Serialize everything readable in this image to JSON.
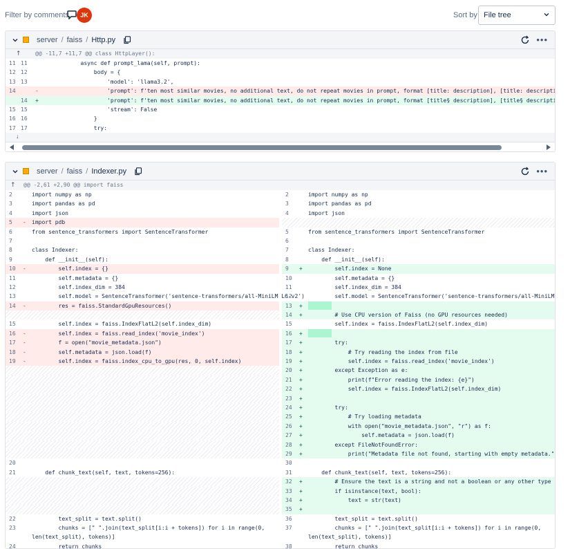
{
  "topbar": {
    "filter_label": "Filter by comments",
    "avatar_initials": "JK",
    "avatar_color": "#de350b",
    "sort_label": "Sort by",
    "sort_value": "File tree"
  },
  "file1": {
    "path": [
      "server",
      "faiss",
      "Http.py"
    ],
    "hunk": "@@ -11,7 +11,7 @@ class HttpLayer():",
    "lines": [
      {
        "o": "11",
        "n": "11",
        "m": "",
        "t": "        async def prompt_lama(self, prompt):",
        "k": "ctx"
      },
      {
        "o": "12",
        "n": "12",
        "m": "",
        "t": "            body = {",
        "k": "ctx"
      },
      {
        "o": "13",
        "n": "13",
        "m": "",
        "t": "                'model': 'llama3.2',",
        "k": "ctx"
      },
      {
        "o": "14",
        "n": "",
        "m": "-",
        "t": "                'prompt': f'ten most similar movies, no additional text, do not repeat movies in prompt, format [title: description], [title: description], given the followi",
        "k": "del"
      },
      {
        "o": "",
        "n": "14",
        "m": "+",
        "t": "                'prompt': f'ten most similar movies, no additional text, do not repeat movies in prompt, format [title§ description], [title§ description], given the followi",
        "k": "add"
      },
      {
        "o": "15",
        "n": "15",
        "m": "",
        "t": "                'stream': False",
        "k": "ctx"
      },
      {
        "o": "16",
        "n": "16",
        "m": "",
        "t": "            }",
        "k": "ctx"
      },
      {
        "o": "17",
        "n": "17",
        "m": "",
        "t": "            try:",
        "k": "ctx"
      }
    ]
  },
  "file2": {
    "path": [
      "server",
      "faiss",
      "Indexer.py"
    ],
    "hunk": "@@ -2,61 +2,90 @@ import faiss",
    "left": [
      {
        "n": "2",
        "m": "",
        "t": "import numpy as np",
        "k": "ctx"
      },
      {
        "n": "3",
        "m": "",
        "t": "import pandas as pd",
        "k": "ctx"
      },
      {
        "n": "4",
        "m": "",
        "t": "import json",
        "k": "ctx"
      },
      {
        "n": "5",
        "m": "-",
        "t": "import pdb",
        "k": "del"
      },
      {
        "n": "6",
        "m": "",
        "t": "from sentence_transformers import SentenceTransformer",
        "k": "ctx"
      },
      {
        "n": "7",
        "m": "",
        "t": "",
        "k": "ctx"
      },
      {
        "n": "8",
        "m": "",
        "t": "class Indexer:",
        "k": "ctx"
      },
      {
        "n": "9",
        "m": "",
        "t": "    def __init__(self):",
        "k": "ctx"
      },
      {
        "n": "10",
        "m": "-",
        "t": "        self.index = {}",
        "k": "del"
      },
      {
        "n": "11",
        "m": "",
        "t": "        self.metadata = {}",
        "k": "ctx"
      },
      {
        "n": "12",
        "m": "",
        "t": "        self.index_dim = 384",
        "k": "ctx"
      },
      {
        "n": "13",
        "m": "",
        "t": "        self.model = SentenceTransformer('sentence-transformers/all-MiniLM-L6-v2')",
        "k": "ctx"
      },
      {
        "n": "14",
        "m": "-",
        "t": "        res = faiss.StandardGpuResources()",
        "k": "del"
      },
      {
        "n": "",
        "m": "",
        "t": "",
        "k": "empty"
      },
      {
        "n": "15",
        "m": "",
        "t": "        self.index = faiss.IndexFlatL2(self.index_dim)",
        "k": "ctx"
      },
      {
        "n": "16",
        "m": "-",
        "t": "        self.index = faiss.read_index('movie_index')",
        "k": "del"
      },
      {
        "n": "17",
        "m": "-",
        "t": "        f = open(\"movie_metadata.json\")",
        "k": "del"
      },
      {
        "n": "18",
        "m": "-",
        "t": "        self.metadata = json.load(f)",
        "k": "del"
      },
      {
        "n": "19",
        "m": "-",
        "t": "        self.index = faiss.index_cpu_to_gpu(res, 0, self.index)",
        "k": "del"
      },
      {
        "n": "",
        "m": "",
        "t": "",
        "k": "empty"
      },
      {
        "n": "",
        "m": "",
        "t": "",
        "k": "empty"
      },
      {
        "n": "",
        "m": "",
        "t": "",
        "k": "empty"
      },
      {
        "n": "",
        "m": "",
        "t": "",
        "k": "empty"
      },
      {
        "n": "",
        "m": "",
        "t": "",
        "k": "empty"
      },
      {
        "n": "",
        "m": "",
        "t": "",
        "k": "empty"
      },
      {
        "n": "",
        "m": "",
        "t": "",
        "k": "empty"
      },
      {
        "n": "",
        "m": "",
        "t": "",
        "k": "empty"
      },
      {
        "n": "",
        "m": "",
        "t": "",
        "k": "empty"
      },
      {
        "n": "",
        "m": "",
        "t": "",
        "k": "empty"
      },
      {
        "n": "20",
        "m": "",
        "t": "",
        "k": "ctx"
      },
      {
        "n": "21",
        "m": "",
        "t": "    def chunk_text(self, text, tokens=256):",
        "k": "ctx"
      },
      {
        "n": "",
        "m": "",
        "t": "",
        "k": "empty"
      },
      {
        "n": "",
        "m": "",
        "t": "",
        "k": "empty"
      },
      {
        "n": "",
        "m": "",
        "t": "",
        "k": "empty"
      },
      {
        "n": "",
        "m": "",
        "t": "",
        "k": "empty"
      },
      {
        "n": "22",
        "m": "",
        "t": "        text_split = text.split()",
        "k": "ctx"
      },
      {
        "n": "23",
        "m": "",
        "t": "        chunks = [\" \".join(text_split[i:i + tokens]) for i in range(0,",
        "k": "ctx"
      },
      {
        "n": "",
        "m": "",
        "t": "len(text_split), tokens)]",
        "k": "ctx"
      },
      {
        "n": "24",
        "m": "",
        "t": "        return chunks",
        "k": "ctx"
      }
    ],
    "right": [
      {
        "n": "2",
        "m": "",
        "t": "import numpy as np",
        "k": "ctx"
      },
      {
        "n": "3",
        "m": "",
        "t": "import pandas as pd",
        "k": "ctx"
      },
      {
        "n": "4",
        "m": "",
        "t": "import json",
        "k": "ctx"
      },
      {
        "n": "",
        "m": "",
        "t": "",
        "k": "empty"
      },
      {
        "n": "5",
        "m": "",
        "t": "from sentence_transformers import SentenceTransformer",
        "k": "ctx"
      },
      {
        "n": "6",
        "m": "",
        "t": "",
        "k": "ctx"
      },
      {
        "n": "7",
        "m": "",
        "t": "class Indexer:",
        "k": "ctx"
      },
      {
        "n": "8",
        "m": "",
        "t": "    def __init__(self):",
        "k": "ctx"
      },
      {
        "n": "9",
        "m": "+",
        "t": "        self.index = None",
        "k": "add"
      },
      {
        "n": "10",
        "m": "",
        "t": "        self.metadata = {}",
        "k": "ctx"
      },
      {
        "n": "11",
        "m": "",
        "t": "        self.index_dim = 384",
        "k": "ctx"
      },
      {
        "n": "12",
        "m": "",
        "t": "        self.model = SentenceTransformer('sentence-transformers/all-MiniLM-L6-v2')",
        "k": "ctx"
      },
      {
        "n": "13",
        "m": "+",
        "t": "",
        "k": "addbox"
      },
      {
        "n": "14",
        "m": "+",
        "t": "        # Use CPU version of Faiss (no GPU resources needed)",
        "k": "add"
      },
      {
        "n": "15",
        "m": "",
        "t": "        self.index = faiss.IndexFlatL2(self.index_dim)",
        "k": "ctx"
      },
      {
        "n": "16",
        "m": "+",
        "t": "",
        "k": "addbox"
      },
      {
        "n": "17",
        "m": "+",
        "t": "        try:",
        "k": "add"
      },
      {
        "n": "18",
        "m": "+",
        "t": "            # Try reading the index from file",
        "k": "add"
      },
      {
        "n": "19",
        "m": "+",
        "t": "            self.index = faiss.read_index('movie_index')",
        "k": "add"
      },
      {
        "n": "20",
        "m": "+",
        "t": "        except Exception as e:",
        "k": "add"
      },
      {
        "n": "21",
        "m": "+",
        "t": "            print(f\"Error reading the index: {e}\")",
        "k": "add"
      },
      {
        "n": "22",
        "m": "+",
        "t": "            self.index = faiss.IndexFlatL2(self.index_dim)",
        "k": "add"
      },
      {
        "n": "23",
        "m": "+",
        "t": "",
        "k": "add"
      },
      {
        "n": "24",
        "m": "+",
        "t": "        try:",
        "k": "add"
      },
      {
        "n": "25",
        "m": "+",
        "t": "            # Try loading metadata",
        "k": "add"
      },
      {
        "n": "26",
        "m": "+",
        "t": "            with open(\"movie_metadata.json\", \"r\") as f:",
        "k": "add"
      },
      {
        "n": "27",
        "m": "+",
        "t": "                self.metadata = json.load(f)",
        "k": "add"
      },
      {
        "n": "28",
        "m": "+",
        "t": "        except FileNotFoundError:",
        "k": "add"
      },
      {
        "n": "29",
        "m": "+",
        "t": "            print(\"Metadata file not found, starting with empty metadata.\")",
        "k": "add"
      },
      {
        "n": "30",
        "m": "",
        "t": "",
        "k": "ctx"
      },
      {
        "n": "31",
        "m": "",
        "t": "    def chunk_text(self, text, tokens=256):",
        "k": "ctx"
      },
      {
        "n": "32",
        "m": "+",
        "t": "        # Ensure the text is a string and not a boolean or any other type",
        "k": "add"
      },
      {
        "n": "33",
        "m": "+",
        "t": "        if isinstance(text, bool):",
        "k": "add"
      },
      {
        "n": "34",
        "m": "+",
        "t": "            text = str(text)",
        "k": "add"
      },
      {
        "n": "35",
        "m": "+",
        "t": "",
        "k": "add"
      },
      {
        "n": "36",
        "m": "",
        "t": "        text_split = text.split()",
        "k": "ctx"
      },
      {
        "n": "37",
        "m": "",
        "t": "        chunks = [\" \".join(text_split[i:i + tokens]) for i in range(0,",
        "k": "ctx"
      },
      {
        "n": "",
        "m": "",
        "t": "len(text_split), tokens)]",
        "k": "ctx"
      },
      {
        "n": "38",
        "m": "",
        "t": "        return chunks",
        "k": "ctx"
      }
    ]
  },
  "colors": {
    "del_bg": "#ffebe9",
    "add_bg": "#e3fcef",
    "accent": "#0052cc"
  },
  "icons": {
    "comment": "comment-icon",
    "copy": "copy-icon",
    "refresh": "refresh-icon",
    "more": "more-icon",
    "chevron": "chevron-down-icon",
    "expand_up": "expand-up-icon",
    "expand_down": "expand-down-icon"
  }
}
